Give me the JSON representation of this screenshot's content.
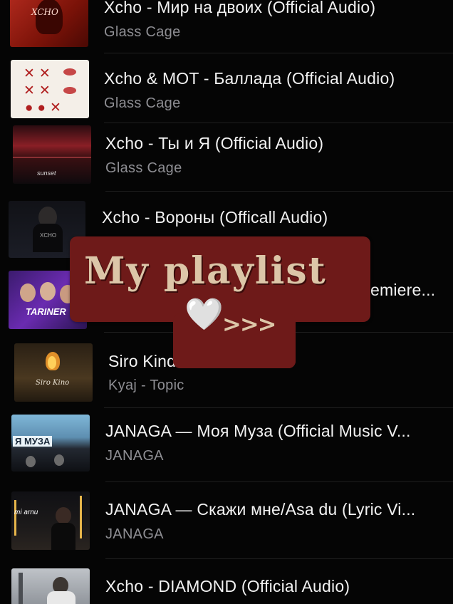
{
  "tracks": [
    {
      "title": "Xcho - Мир на двоих (Official Audio)",
      "subtitle": "Glass Cage",
      "thumb_icon": "album-art-red-xcho"
    },
    {
      "title": "Xcho & MOT - Баллада (Official Audio)",
      "subtitle": "Glass Cage",
      "thumb_icon": "album-art-xx-kisses"
    },
    {
      "title": "Xcho - Ты и Я (Official Audio)",
      "subtitle": "Glass Cage",
      "thumb_icon": "album-art-sunset"
    },
    {
      "title": "Xcho - Вороны (Officall Audio)",
      "subtitle": "",
      "thumb_icon": "album-art-xcho-portrait"
    },
    {
      "title": "emiere...",
      "subtitle": "",
      "thumb_icon": "album-art-tariner"
    },
    {
      "title": "Siro Kind",
      "subtitle": "Kyaj - Topic",
      "thumb_icon": "album-art-siro-kino"
    },
    {
      "title": "JANAGA —  Моя Муза (Official Music V...",
      "subtitle": "JANAGA",
      "thumb_icon": "album-art-moya-muza"
    },
    {
      "title": "JANAGA — Скажи мне/Asa du (Lyric Vi...",
      "subtitle": "JANAGA",
      "thumb_icon": "album-art-night-street"
    },
    {
      "title": "Xcho - DIAMOND (Official Audio)",
      "subtitle": "",
      "thumb_icon": "album-art-diamond"
    }
  ],
  "sticker": {
    "text": "My playlist",
    "heart": "🤍",
    "arrows": ">>>"
  },
  "colors": {
    "background": "#050505",
    "sticker": "#6e1a19",
    "sticker_text": "#dcc6a8",
    "subtitle": "#8e8e93"
  }
}
